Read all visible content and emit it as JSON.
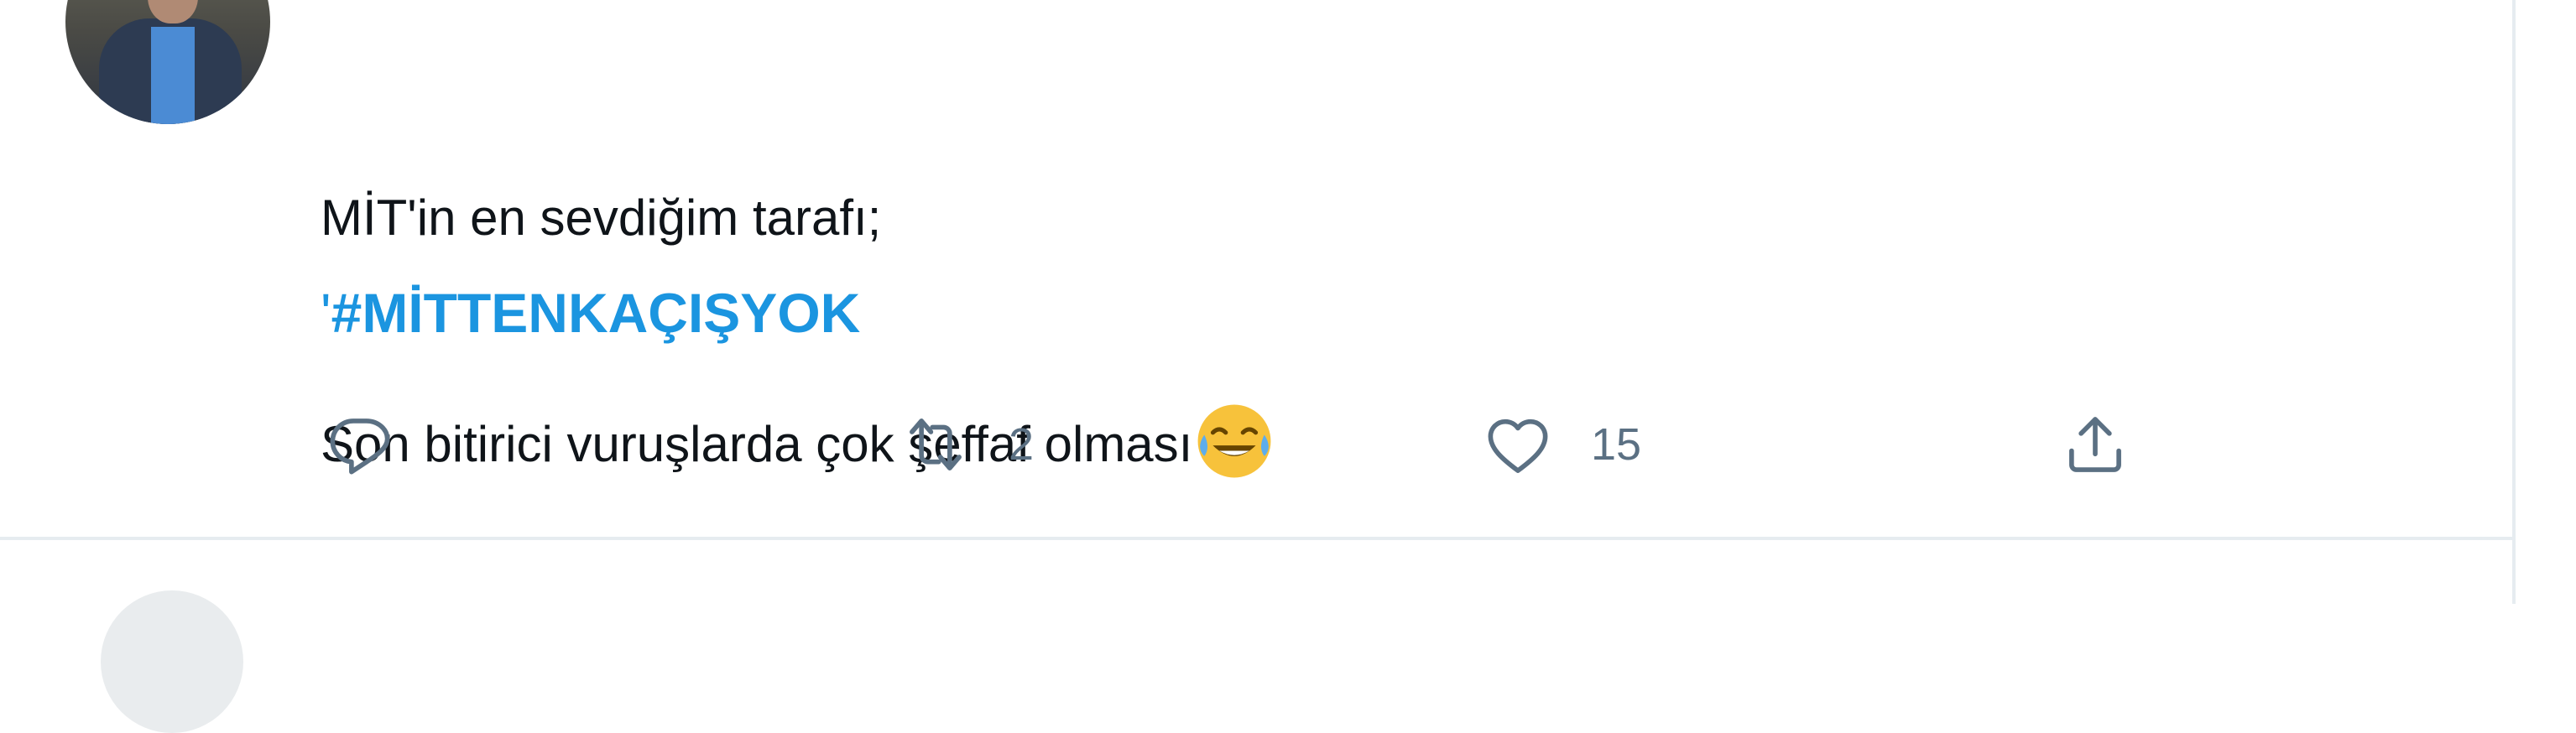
{
  "tweet": {
    "lines": [
      "MİT'in en sevdiğim tarafı;",
      "Son bitirici vuruşlarda çok şeffaf olması"
    ],
    "hashtag_prefix": "'",
    "hashtag": "#MİTTENKAÇIŞYOK",
    "emoji": "face-with-tears-of-joy-emoji",
    "actions": {
      "reply": {
        "icon": "reply-icon",
        "count": ""
      },
      "retweet": {
        "icon": "retweet-icon",
        "count": "2"
      },
      "like": {
        "icon": "heart-icon",
        "count": "15"
      },
      "share": {
        "icon": "share-icon",
        "count": ""
      }
    }
  },
  "colors": {
    "link": "#1b95e0",
    "icon": "#5b7083",
    "text": "#0f1419",
    "border": "#e6ecf0"
  }
}
